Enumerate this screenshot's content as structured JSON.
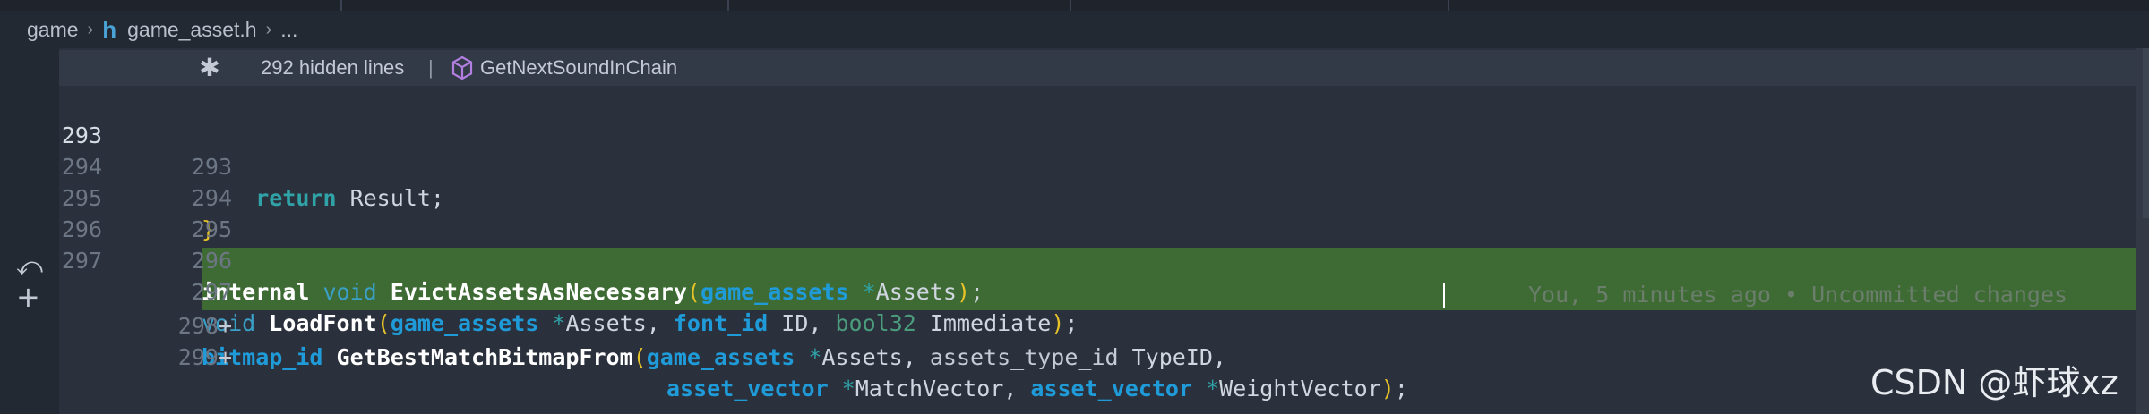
{
  "breadcrumb": {
    "folder": "game",
    "file_icon": "h",
    "file": "game_asset.h",
    "ellipsis": "..."
  },
  "fold_header": {
    "hidden_lines": "292 hidden lines",
    "separator": "|",
    "symbol_icon": "cube-icon",
    "symbol": "GetNextSoundInChain"
  },
  "lines": [
    {
      "old": "293",
      "new": "293",
      "mark": ""
    },
    {
      "old": "294",
      "new": "294",
      "mark": ""
    },
    {
      "old": "295",
      "new": "295",
      "mark": ""
    },
    {
      "old": "296",
      "new": "296",
      "mark": ""
    },
    {
      "old": "297",
      "new": "297",
      "mark": ""
    },
    {
      "old": "",
      "new": "298",
      "mark": "+"
    },
    {
      "old": "",
      "new": "299",
      "mark": "+"
    }
  ],
  "code": {
    "l293": {
      "kw": "return",
      "rest": " Result;"
    },
    "l294": {
      "brace": "}"
    },
    "l296": {
      "a": "internal",
      "b": "void",
      "fn": "EvictAssetsAsNecessary",
      "p1": "(",
      "type": "game_assets",
      "ptr": " *",
      "arg": "Assets",
      "p2": ")",
      "end": ";"
    },
    "l297": {
      "void": "void",
      "fn": "LoadFont",
      "p1": "(",
      "t1": "game_assets",
      "ptr1": " *",
      "a1": "Assets, ",
      "t2": "font_id",
      "a2": " ID, ",
      "t3": "bool32",
      "a3": " Immediate",
      "p2": ")",
      "end": ";"
    },
    "l298": {
      "t0": "bitmap_id",
      "fn": "GetBestMatchBitmapFrom",
      "p1": "(",
      "t1": "game_assets",
      "ptr1": " *",
      "a1": "Assets, ",
      "t2": "assets_type_id",
      "a2": " TypeID,"
    },
    "l299": {
      "t1": "asset_vector",
      "ptr1": " *",
      "a1": "MatchVector, ",
      "t2": "asset_vector",
      "ptr2": " *",
      "a2": "WeightVector",
      "p2": ")",
      "end": ";"
    }
  },
  "blame": "You, 5 minutes ago • Uncommitted changes",
  "gutter_icons": [
    "undo-icon",
    "plus-icon"
  ],
  "watermark": "CSDN @虾球xz",
  "colors": {
    "added_line": "#3e6b34",
    "type_keyword": "#1e9bd8",
    "paren": "#e6c229",
    "editor_bg": "#2b313c"
  }
}
